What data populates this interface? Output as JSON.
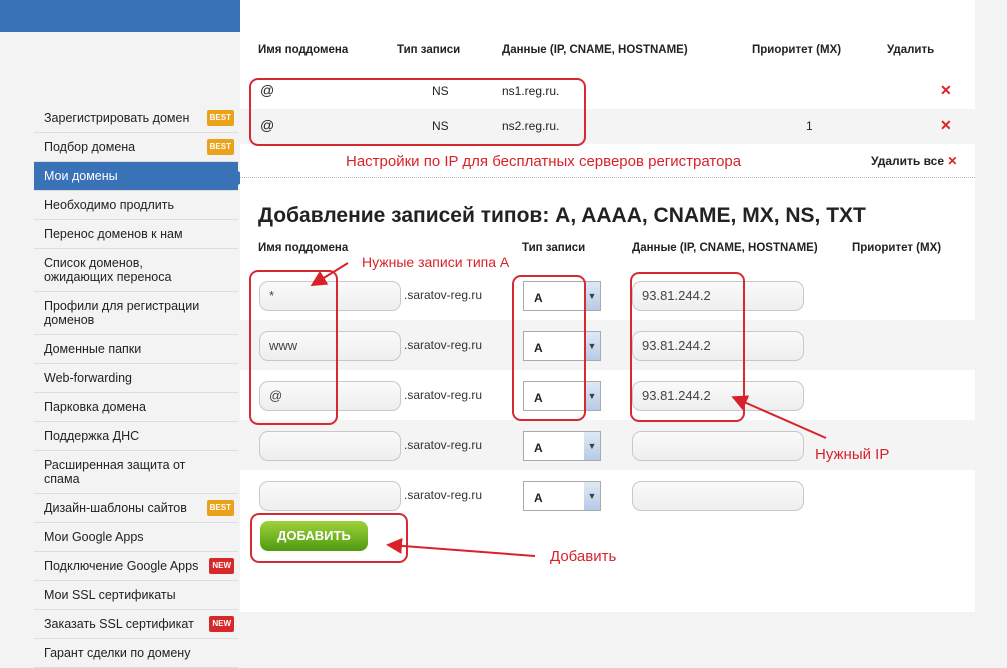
{
  "sidebar": {
    "items": [
      {
        "label": "Зарегистрировать домен",
        "badge": "BEST"
      },
      {
        "label": "Подбор домена",
        "badge": "BEST"
      },
      {
        "label": "Мои домены",
        "active": true
      },
      {
        "label": "Необходимо продлить"
      },
      {
        "label": "Перенос доменов к нам"
      },
      {
        "label": "Список доменов, ожидающих переноса"
      },
      {
        "label": "Профили для регистрации доменов"
      },
      {
        "label": "Доменные папки"
      },
      {
        "label": "Web-forwarding"
      },
      {
        "label": "Парковка домена"
      },
      {
        "label": "Поддержка ДНС"
      },
      {
        "label": "Расширенная защита от спама"
      },
      {
        "label": "Дизайн-шаблоны сайтов",
        "badge": "BEST"
      },
      {
        "label": "Мои Google Apps"
      },
      {
        "label": "Подключение Google Apps",
        "badge": "NEW"
      },
      {
        "label": "Мои SSL сертификаты"
      },
      {
        "label": "Заказать SSL сертификат",
        "badge": "NEW"
      },
      {
        "label": "Гарант сделки по домену"
      }
    ]
  },
  "ns_table": {
    "headers": [
      "Имя поддомена",
      "Тип записи",
      "Данные (IP, CNAME, HOSTNAME)",
      "Приоритет (MX)",
      "Удалить"
    ],
    "rows": [
      {
        "name": "@",
        "type": "NS",
        "data": "ns1.reg.ru.",
        "priority": ""
      },
      {
        "name": "@",
        "type": "NS",
        "data": "ns2.reg.ru.",
        "priority": "1"
      }
    ],
    "delete_all": "Удалить все"
  },
  "annotations": {
    "ns": "Настройки по IP для бесплатных серверов регистратора",
    "a_records": "Нужные записи типа А",
    "ip": "Нужный IP",
    "add": "Добавить"
  },
  "add_section": {
    "title": "Добавление записей типов: A, AAAA, CNAME, MX, NS, TXT",
    "headers": [
      "Имя поддомена",
      "Тип записи",
      "Данные (IP, CNAME, HOSTNAME)",
      "Приоритет (MX)"
    ],
    "suffix": ".saratov-reg.ru",
    "rows": [
      {
        "name": "*",
        "type": "A",
        "data": "93.81.244.2"
      },
      {
        "name": "www",
        "type": "A",
        "data": "93.81.244.2"
      },
      {
        "name": "@",
        "type": "A",
        "data": "93.81.244.2"
      },
      {
        "name": "",
        "type": "A",
        "data": ""
      },
      {
        "name": "",
        "type": "A",
        "data": ""
      }
    ],
    "add_button": "ДОБАВИТЬ"
  },
  "colors": {
    "accent": "#3a72b8",
    "annotation": "#d8222a",
    "button": "#6cb21e"
  }
}
